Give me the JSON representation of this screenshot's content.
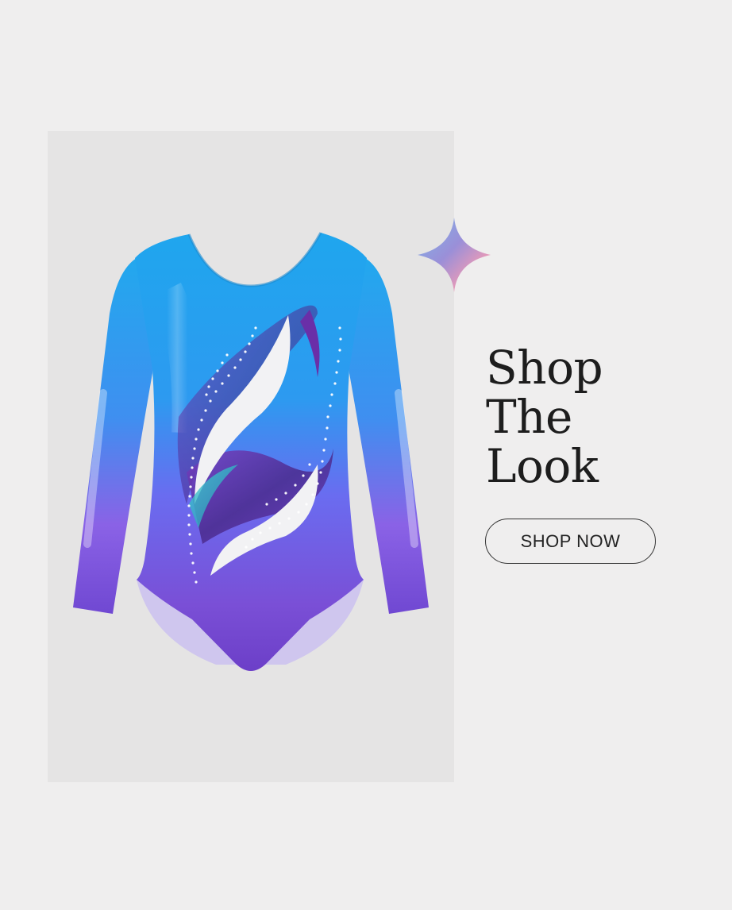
{
  "product": {
    "image": "leotard-image",
    "colors": {
      "top": "#1fa6ee",
      "middle": "#6a6cf0",
      "bottom": "#6c3fc8",
      "accent_white": "#f2f2f4",
      "accent_purple": "#5b2a9a"
    }
  },
  "decoration": {
    "icon": "sparkle-icon"
  },
  "headline": {
    "line1": "Shop",
    "line2": "The",
    "line3": "Look"
  },
  "cta": {
    "label": "SHOP NOW"
  }
}
